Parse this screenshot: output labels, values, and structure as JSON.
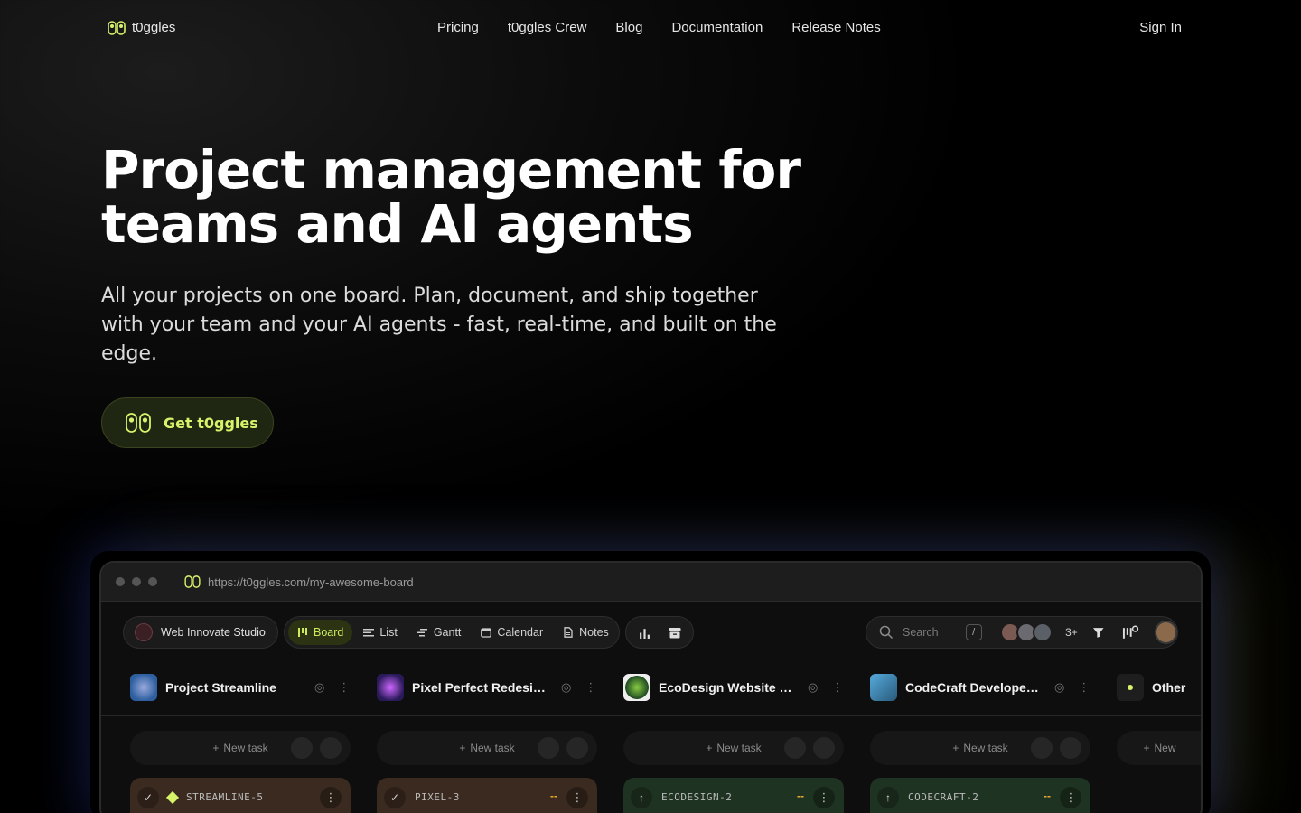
{
  "nav": {
    "logo_text": "t0ggles",
    "links": [
      "Pricing",
      "t0ggles Crew",
      "Blog",
      "Documentation",
      "Release Notes"
    ],
    "sign_in": "Sign In"
  },
  "hero": {
    "title": "Project management for teams and AI agents",
    "subtitle": "All your projects on one board. Plan, document, and ship together with your team and your AI agents - fast, real-time, and built on the edge.",
    "cta_label": "Get t0ggles"
  },
  "app": {
    "url": "https://t0ggles.com/my-awesome-board",
    "workspace": "Web Innovate Studio",
    "views": [
      {
        "label": "Board",
        "icon": "board-icon",
        "active": true
      },
      {
        "label": "List",
        "icon": "list-icon",
        "active": false
      },
      {
        "label": "Gantt",
        "icon": "gantt-icon",
        "active": false
      },
      {
        "label": "Calendar",
        "icon": "calendar-icon",
        "active": false
      },
      {
        "label": "Notes",
        "icon": "notes-icon",
        "active": false
      }
    ],
    "search_placeholder": "Search",
    "search_shortcut": "/",
    "members_more": "3+",
    "columns": [
      {
        "name": "Project Streamline",
        "color": "#2e5fa0",
        "new_task": "New task",
        "card_id": "STREAMLINE-5",
        "card_bg": "#3a2a1f",
        "priority": ""
      },
      {
        "name": "Pixel Perfect Redesi…",
        "color": "#5a2fa0",
        "new_task": "New task",
        "card_id": "PIXEL-3",
        "card_bg": "#3a2a1f",
        "priority": "--"
      },
      {
        "name": "EcoDesign Website …",
        "color": "#2f8a3a",
        "new_task": "New task",
        "card_id": "ECODESIGN-2",
        "card_bg": "#1f3322",
        "priority": "--"
      },
      {
        "name": "CodeCraft Develope…",
        "color": "#3a7aa0",
        "new_task": "New task",
        "card_id": "CODECRAFT-2",
        "card_bg": "#1f3322",
        "priority": "--"
      },
      {
        "name": "Other",
        "color": "#d7f36a",
        "new_task": "New",
        "card_id": "",
        "card_bg": "",
        "priority": ""
      }
    ],
    "accent": "#d7f36a"
  }
}
